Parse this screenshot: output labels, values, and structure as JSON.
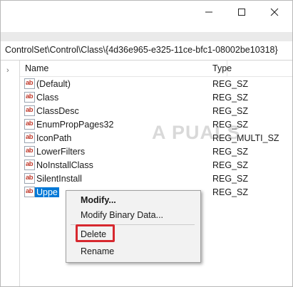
{
  "window": {
    "controls": [
      {
        "name": "minimize-button",
        "glyph": "minimize-icon"
      },
      {
        "name": "maximize-button",
        "glyph": "maximize-icon"
      },
      {
        "name": "close-button",
        "glyph": "close-icon"
      }
    ]
  },
  "address_bar": {
    "path": "ControlSet\\Control\\Class\\{4d36e965-e325-11ce-bfc1-08002be10318}"
  },
  "columns": {
    "name": "Name",
    "type": "Type"
  },
  "rows": [
    {
      "name": "(Default)",
      "type": "REG_SZ"
    },
    {
      "name": "Class",
      "type": "REG_SZ"
    },
    {
      "name": "ClassDesc",
      "type": "REG_SZ"
    },
    {
      "name": "EnumPropPages32",
      "type": "REG_SZ"
    },
    {
      "name": "IconPath",
      "type": "REG_MULTI_SZ"
    },
    {
      "name": "LowerFilters",
      "type": "REG_SZ"
    },
    {
      "name": "NoInstallClass",
      "type": "REG_SZ"
    },
    {
      "name": "SilentInstall",
      "type": "REG_SZ"
    },
    {
      "name": "Uppe",
      "type": "REG_SZ"
    }
  ],
  "icon_label": "ab",
  "watermark": "A PUALS",
  "context_menu": {
    "modify": "Modify...",
    "modify_binary": "Modify Binary Data...",
    "delete": "Delete",
    "rename": "Rename"
  },
  "colors": {
    "selection": "#0078d7",
    "highlight_box": "#d7282f",
    "reg_icon_text": "#c0392b"
  }
}
